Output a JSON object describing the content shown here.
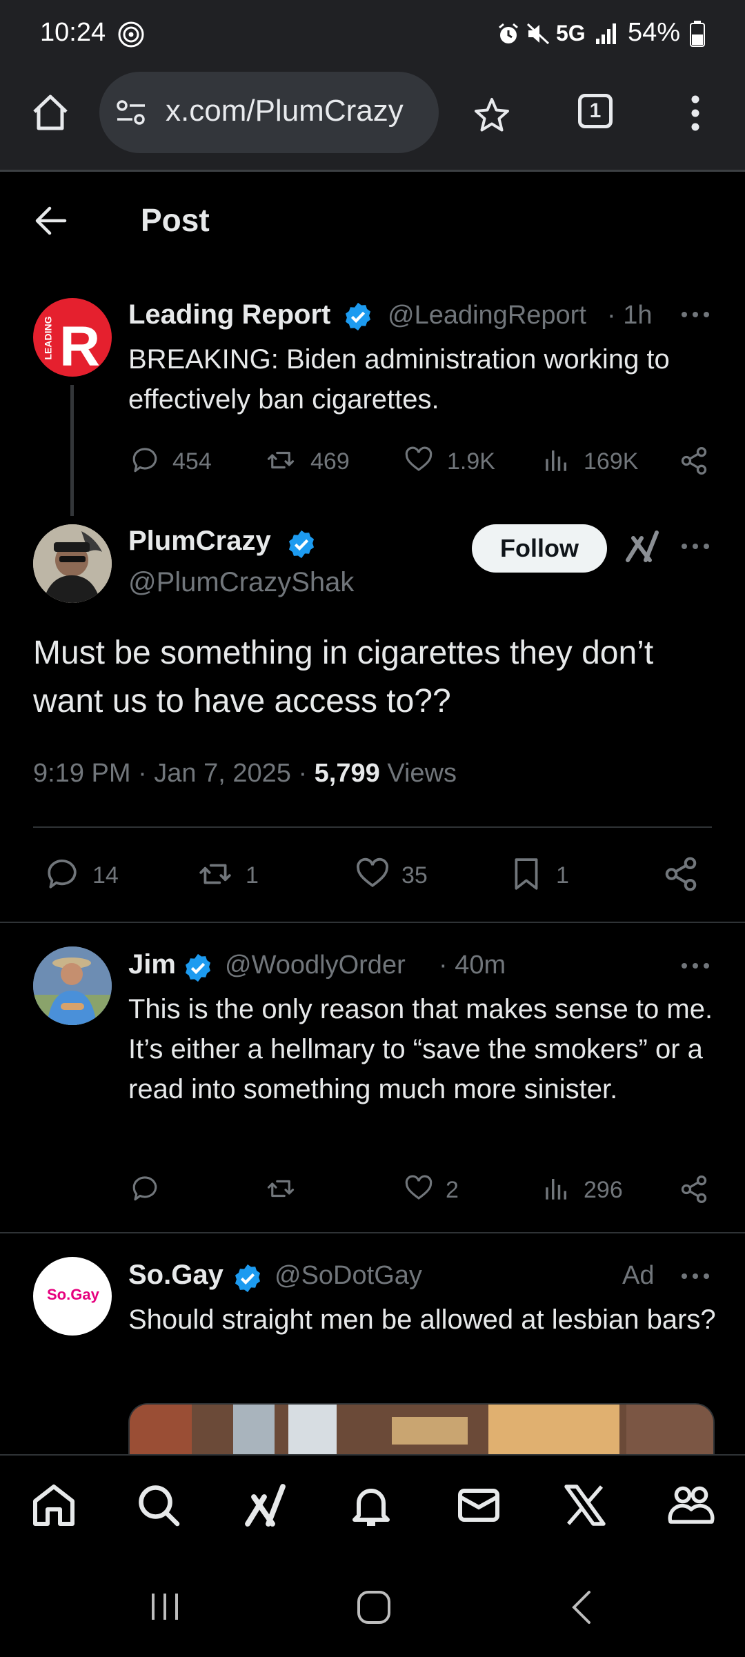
{
  "status_bar": {
    "time": "10:24",
    "network": "5G",
    "battery": "54%"
  },
  "browser": {
    "url": "x.com/PlumCrazy",
    "tab_count": "1"
  },
  "header": {
    "title": "Post"
  },
  "quoted_post": {
    "name": "Leading Report",
    "handle": "@LeadingReport",
    "time": "· 1h",
    "avatar_text": "LEADING",
    "text": "BREAKING: Biden administration working to effectively ban cigarettes.",
    "replies": "454",
    "reposts": "469",
    "likes": "1.9K",
    "views": "169K"
  },
  "main_post": {
    "name": "PlumCrazy",
    "handle": "@PlumCrazyShak",
    "follow_label": "Follow",
    "text": "Must be something in cigarettes they don’t want us to have access to??",
    "timestamp": "9:19 PM · Jan 7, 2025 · ",
    "views_count": "5,799",
    "views_label": " Views",
    "replies": "14",
    "reposts": "1",
    "likes": "35",
    "bookmarks": "1"
  },
  "reply_post": {
    "name": "Jim",
    "handle": "@WoodlyOrder",
    "time": "· 40m",
    "text": "This is the only reason that makes sense to me. It’s either a hellmary to “save the smokers” or a read into something much more sinister.",
    "likes": "2",
    "views": "296"
  },
  "ad_post": {
    "name": "So.Gay",
    "handle": "@SoDotGay",
    "ad_label": "Ad",
    "avatar_text": "So.Gay",
    "text": "Should straight men be allowed at lesbian bars?"
  },
  "bottom_nav": [
    "home-icon",
    "search-icon",
    "grok-icon",
    "notifications-icon",
    "messages-icon",
    "x-premium-icon",
    "communities-icon"
  ],
  "colors": {
    "verified": "#1d9bf0",
    "background": "#000000",
    "muted": "#71767b",
    "leading_red": "#e5202e",
    "sogay_pink": "#e6007e"
  }
}
